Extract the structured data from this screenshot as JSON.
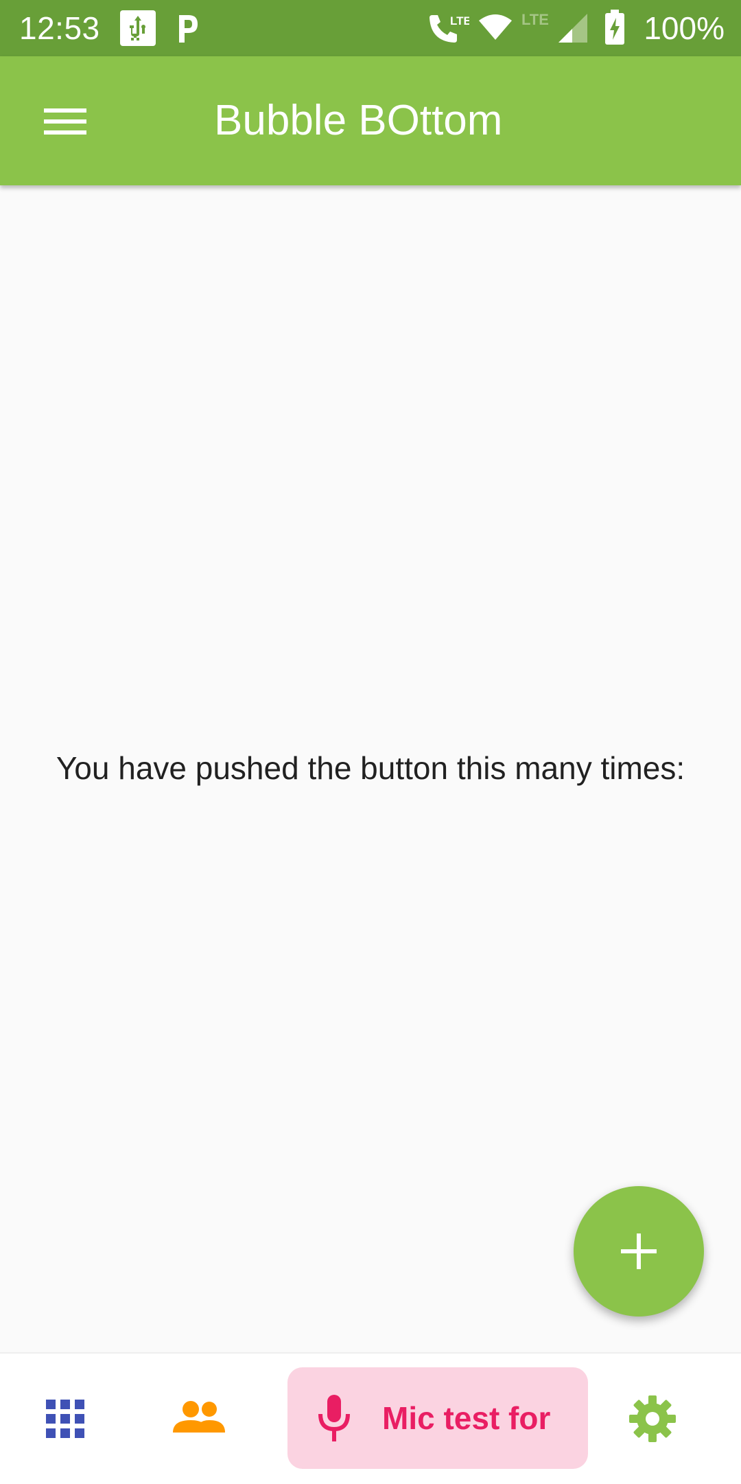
{
  "status_bar": {
    "time": "12:53",
    "battery": "100%",
    "network_label": "LTE",
    "icons": [
      "usb-icon",
      "parking-icon",
      "lte-call-icon",
      "wifi-icon",
      "signal-icon",
      "battery-charging-icon"
    ]
  },
  "app_bar": {
    "title": "Bubble BOttom",
    "menu_icon": "menu-icon"
  },
  "body": {
    "counter_text": "You have pushed the button this many times:"
  },
  "fab": {
    "icon": "add-icon"
  },
  "bottom_nav": {
    "items": [
      {
        "icon": "apps-icon",
        "label": "",
        "color": "#3f51b5"
      },
      {
        "icon": "people-icon",
        "label": "",
        "color": "#ff9800"
      },
      {
        "icon": "mic-icon",
        "label": "Mic test for",
        "color": "#e91e63",
        "selected": true
      },
      {
        "icon": "settings-icon",
        "label": "",
        "color": "#8bc34a"
      }
    ]
  },
  "colors": {
    "status_bar": "#689f38",
    "app_bar": "#8bc34a",
    "background": "#fafafa",
    "mic_bubble": "#fbd3e1",
    "mic_accent": "#e91e63"
  }
}
